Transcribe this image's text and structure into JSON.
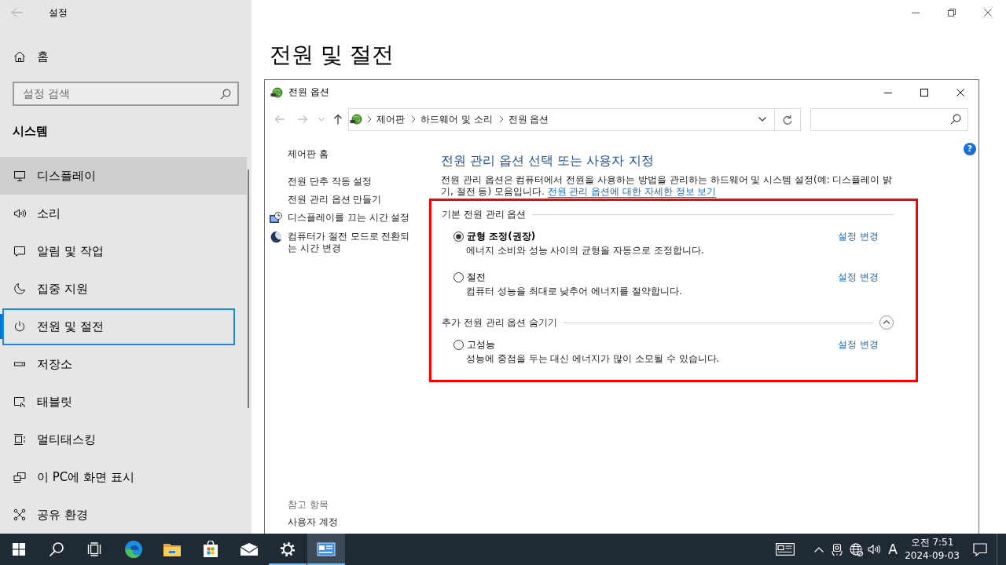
{
  "settings": {
    "title": "설정",
    "home": "홈",
    "search": {
      "placeholder": "설정 검색"
    },
    "section": "시스템",
    "nav": [
      {
        "label": "디스플레이",
        "kind": "display",
        "selected": false,
        "hovered": true
      },
      {
        "label": "소리",
        "kind": "sound",
        "selected": false,
        "hovered": false
      },
      {
        "label": "알림 및 작업",
        "kind": "notifications",
        "selected": false,
        "hovered": false
      },
      {
        "label": "집중 지원",
        "kind": "focus",
        "selected": false,
        "hovered": false
      },
      {
        "label": "전원 및 절전",
        "kind": "power",
        "selected": true,
        "hovered": false
      },
      {
        "label": "저장소",
        "kind": "storage",
        "selected": false,
        "hovered": false
      },
      {
        "label": "태블릿",
        "kind": "tablet",
        "selected": false,
        "hovered": false
      },
      {
        "label": "멀티태스킹",
        "kind": "multitasking",
        "selected": false,
        "hovered": false
      },
      {
        "label": "이 PC에 화면 표시",
        "kind": "project",
        "selected": false,
        "hovered": false
      },
      {
        "label": "공유 환경",
        "kind": "shared",
        "selected": false,
        "hovered": false
      }
    ],
    "heading": "전원 및 절전"
  },
  "power_window": {
    "title": "전원 옵션",
    "nav_buttons": [
      {
        "kind": "back",
        "disabled": true
      },
      {
        "kind": "forward",
        "disabled": true
      },
      {
        "kind": "recent",
        "disabled": true
      },
      {
        "kind": "up",
        "disabled": false
      }
    ],
    "breadcrumb": [
      "제어판",
      "하드웨어 및 소리",
      "전원 옵션"
    ],
    "help": "?",
    "tasks": [
      {
        "label": "제어판 홈",
        "kind": "home"
      },
      {
        "label": "전원 단추 작동 설정",
        "kind": "plain"
      },
      {
        "label": "전원 관리 옵션 만들기",
        "kind": "plain"
      },
      {
        "label": "디스플레이를 끄는 시간 설정",
        "kind": "display-timer"
      },
      {
        "label": "컴퓨터가 절전 모드로 전환되는 시간 변경",
        "kind": "sleep"
      }
    ],
    "see_also": {
      "title": "참고 항목",
      "links": [
        "사용자 계정"
      ]
    },
    "heading": "전원 관리 옵션 선택 또는 사용자 지정",
    "description": "전원 관리 옵션은 컴퓨터에서 전원을 사용하는 방법을 관리하는 하드웨어 및 시스템 설정(예: 디스플레이 밝기, 절전 등) 모음입니다.",
    "description_link": "전원 관리 옵션에 대한 자세한 정보 보기",
    "plans_panel": {
      "highlighted": true,
      "groups": [
        {
          "title": "기본 전원 관리 옵션",
          "plans": [
            {
              "name": "균형 조정(권장)",
              "description": "에너지 소비와 성능 사이의 균형을 자동으로 조정합니다.",
              "link": "설정 변경",
              "selected": true
            },
            {
              "name": "절전",
              "description": "컴퓨터 성능을 최대로 낮추어 에너지를 절약합니다.",
              "link": "설정 변경",
              "selected": false
            }
          ]
        },
        {
          "title": "추가 전원 관리 옵션 숨기기",
          "expanded": true,
          "plans": [
            {
              "name": "고성능",
              "description": "성능에 중점을 두는 대신 에너지가 많이 소모될 수 있습니다.",
              "link": "설정 변경",
              "selected": false
            }
          ]
        }
      ]
    }
  },
  "taskbar": {
    "apps": [
      {
        "kind": "browser",
        "running": false,
        "active": false
      },
      {
        "kind": "files",
        "running": false,
        "active": false
      },
      {
        "kind": "store",
        "running": false,
        "active": false
      },
      {
        "kind": "mail",
        "running": false,
        "active": false
      },
      {
        "kind": "settings",
        "running": true,
        "active": false
      },
      {
        "kind": "control-panel",
        "running": true,
        "active": true
      }
    ],
    "ime": "A",
    "time": "오전 7:51",
    "date": "2024-09-03"
  }
}
